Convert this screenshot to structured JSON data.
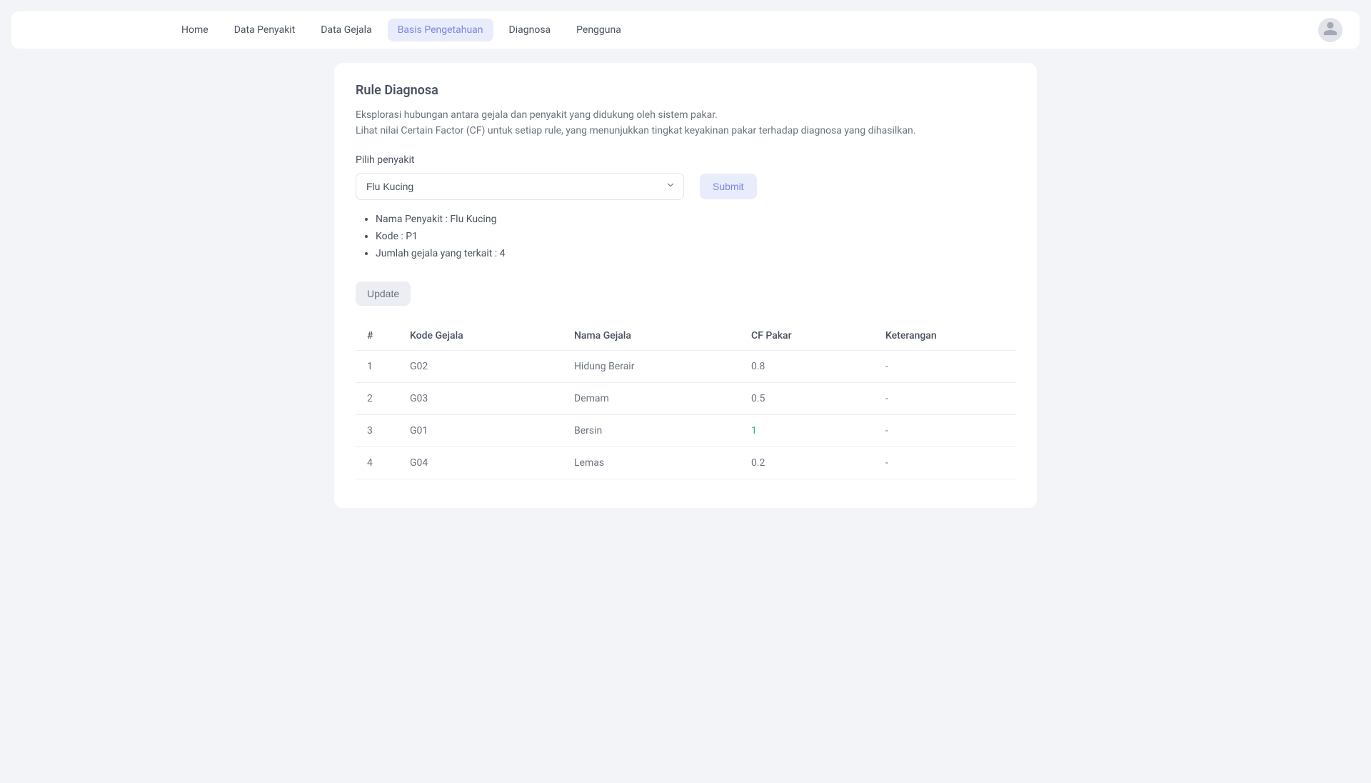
{
  "nav": {
    "items": [
      {
        "label": "Home",
        "active": false
      },
      {
        "label": "Data Penyakit",
        "active": false
      },
      {
        "label": "Data Gejala",
        "active": false
      },
      {
        "label": "Basis Pengetahuan",
        "active": true
      },
      {
        "label": "Diagnosa",
        "active": false
      },
      {
        "label": "Pengguna",
        "active": false
      }
    ]
  },
  "page": {
    "title": "Rule Diagnosa",
    "desc_line1": "Eksplorasi hubungan antara gejala dan penyakit yang didukung oleh sistem pakar.",
    "desc_line2": "Lihat nilai Certain Factor (CF) untuk setiap rule, yang menunjukkan tingkat keyakinan pakar terhadap diagnosa yang dihasilkan."
  },
  "form": {
    "select_label": "Pilih penyakit",
    "selected": "Flu Kucing",
    "submit_label": "Submit",
    "update_label": "Update"
  },
  "info": {
    "nama_label": "Nama Penyakit : ",
    "nama_value": "Flu Kucing",
    "kode_label": "Kode : ",
    "kode_value": "P1",
    "jumlah_label": "Jumlah gejala yang terkait : ",
    "jumlah_value": "4"
  },
  "table": {
    "headers": {
      "num": "#",
      "kode": "Kode Gejala",
      "nama": "Nama Gejala",
      "cf": "CF Pakar",
      "ket": "Keterangan"
    },
    "rows": [
      {
        "num": "1",
        "kode": "G02",
        "nama": "Hidung Berair",
        "cf": "0.8",
        "cf_high": false,
        "ket": "-"
      },
      {
        "num": "2",
        "kode": "G03",
        "nama": "Demam",
        "cf": "0.5",
        "cf_high": false,
        "ket": "-"
      },
      {
        "num": "3",
        "kode": "G01",
        "nama": "Bersin",
        "cf": "1",
        "cf_high": true,
        "ket": "-"
      },
      {
        "num": "4",
        "kode": "G04",
        "nama": "Lemas",
        "cf": "0.2",
        "cf_high": false,
        "ket": "-"
      }
    ]
  }
}
